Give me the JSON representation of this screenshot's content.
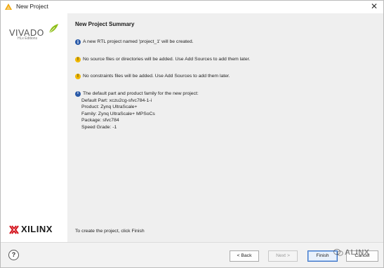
{
  "window": {
    "title": "New Project",
    "close_glyph": "✕"
  },
  "branding": {
    "vivado_word": "VIVADO",
    "vivado_edition": "HLx Editions",
    "xilinx_word": "XILINX"
  },
  "summary": {
    "heading": "New Project Summary",
    "messages": [
      {
        "icon": "info-icon",
        "text": "A new RTL project named 'project_1' will be created."
      },
      {
        "icon": "warning-icon",
        "text": "No source files or directories will be added. Use Add Sources to add them later."
      },
      {
        "icon": "warning-icon",
        "text": "No constraints files will be added. Use Add Sources to add them later."
      }
    ],
    "part_info": {
      "intro": "The default part and product family for the new project:",
      "default_part": "Default Part: xczu2cg-sfvc784-1-i",
      "product": "Product: Zynq UltraScale+",
      "family": "Family: Zynq UltraScale+ MPSoCs",
      "package": "Package: sfvc784",
      "speed_grade": "Speed Grade: -1"
    },
    "footer": "To create the project, click Finish"
  },
  "buttons": {
    "help": "?",
    "back": "< Back",
    "next": "Next >",
    "finish": "Finish",
    "cancel": "Cancel"
  },
  "watermark": "ALINX",
  "colors": {
    "info": "#2a5aa8",
    "warning": "#f0b800",
    "finish_border": "#3a72c6",
    "panel_bg": "#efefef"
  }
}
